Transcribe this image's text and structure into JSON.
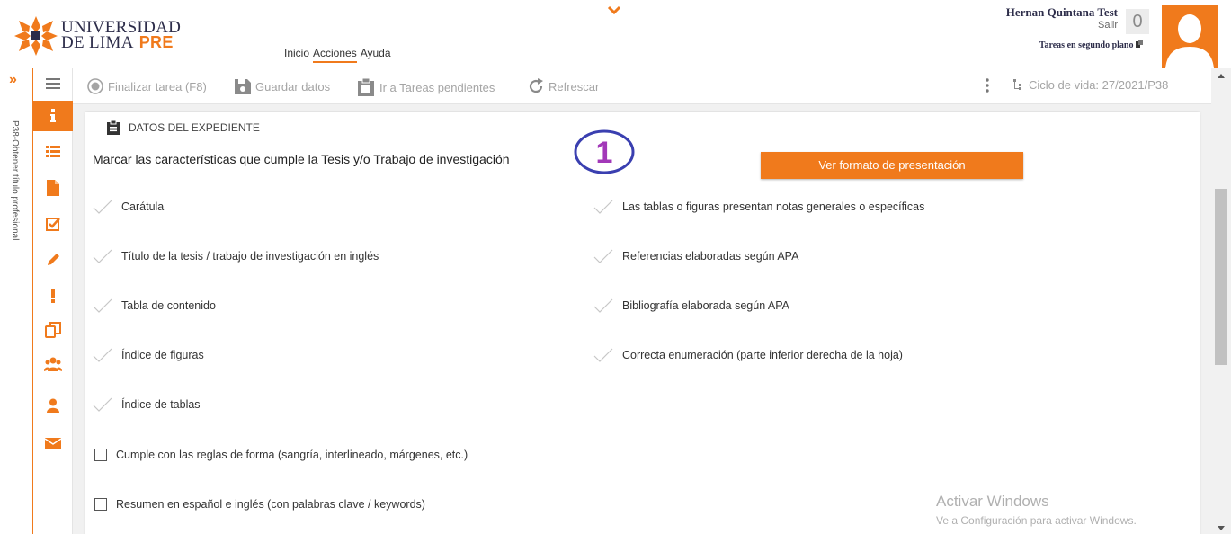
{
  "brand": {
    "line1": "UNIVERSIDAD",
    "line2": "DE LIMA",
    "pre": "PRE",
    "accent": "#f07a1c"
  },
  "nav": {
    "items": [
      "Inicio",
      "Acciones",
      "Ayuda"
    ],
    "active": "Acciones"
  },
  "user": {
    "name": "Hernan Quintana Test",
    "logout": "Salir",
    "bg_tasks": "Tareas en segundo plano",
    "task_count": "0"
  },
  "sidebar_label": "P38-Obtener título profesional",
  "toolbar": {
    "finalize": "Finalizar tarea (F8)",
    "save": "Guardar datos",
    "pending": "Ir a Tareas pendientes",
    "refresh": "Refrescar",
    "lifecycle": "Ciclo de vida: 27/2021/P38"
  },
  "section": {
    "title": "DATOS DEL EXPEDIENTE",
    "question": "Marcar las características que cumple la Tesis y/o Trabajo de investigación",
    "step": "1",
    "format_button": "Ver formato de presentación"
  },
  "checks_left": [
    "Carátula",
    "Título de la tesis / trabajo de investigación en inglés",
    "Tabla de contenido",
    "Índice de figuras",
    "Índice de tablas"
  ],
  "checks_right": [
    "Las tablas o figuras presentan notas generales o específicas",
    "Referencias elaboradas según APA",
    "Bibliografía elaborada según APA",
    "Correcta enumeración (parte inferior derecha de la hoja)"
  ],
  "boxes": [
    "Cumple con las reglas de forma (sangría, interlineado, márgenes, etc.)",
    "Resumen en español e inglés (con palabras clave / keywords)"
  ],
  "watermark": {
    "line1": "Activar Windows",
    "line2": "Ve a Configuración para activar Windows."
  }
}
